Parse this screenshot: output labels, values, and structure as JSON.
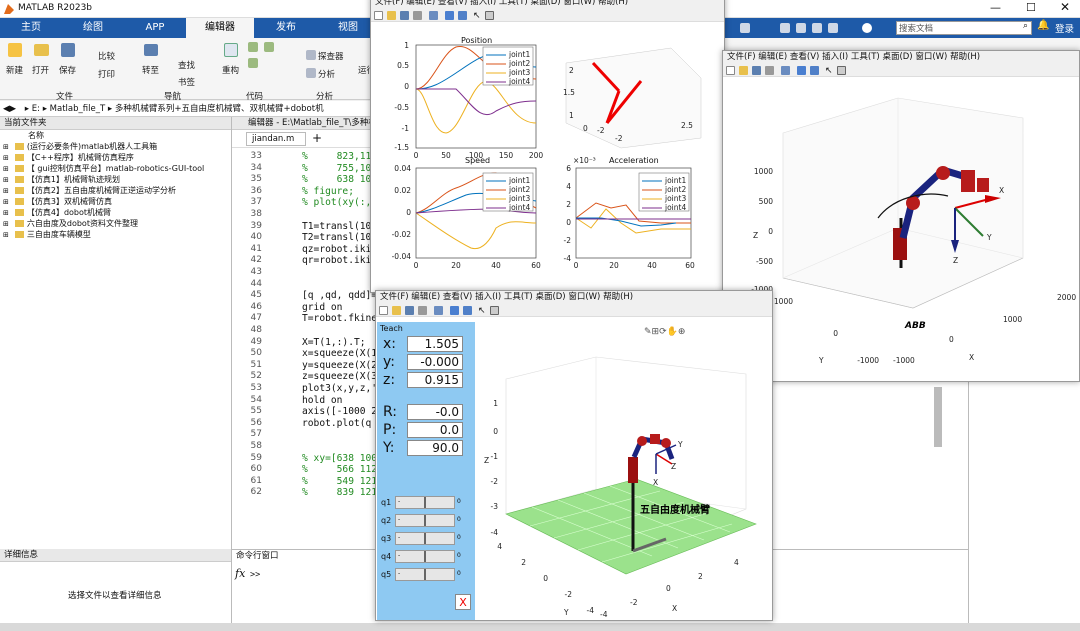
{
  "app": {
    "title": "MATLAB R2023b",
    "search_placeholder": "搜索文档",
    "login": "登录"
  },
  "tabs": [
    "主页",
    "绘图",
    "APP",
    "编辑器",
    "发布",
    "视图"
  ],
  "ribbon": {
    "buttons": [
      "新建",
      "打开",
      "保存",
      "比较",
      "打印",
      "转至",
      "查找",
      "书签",
      "重构",
      "探查器",
      "分析",
      "运行"
    ],
    "groups": [
      "文件",
      "导航",
      "代码",
      "分析"
    ]
  },
  "addressbar": {
    "path": "▸ E: ▸ Matlab_file_T ▸ 多种机械臂系列+五自由度机械臂、双机械臂+dobot机"
  },
  "editor_title": "编辑器 - E:\\Matlab_file_T\\多种机",
  "editor_tab": "jiandan.m",
  "current_folder": {
    "title": "当前文件夹",
    "col_name": "名称",
    "items": [
      "(运行必要条件)matlab机器人工具箱",
      "【C++程序】机械臂仿真程序",
      "【 gui控制仿真平台】matlab-robotics-GUI-tool",
      "【仿真1】机械臂轨迹规划",
      "【仿真2】五自由度机械臂正逆运动学分析",
      "【仿真3】双机械臂仿真",
      "【仿真4】dobot机械臂",
      "六自由度及dobot资料文件整理",
      "三自由度车辆模型"
    ]
  },
  "details": {
    "title": "详细信息",
    "hint": "选择文件以查看详细信息"
  },
  "command_window": {
    "title": "命令行窗口",
    "prompt": ">>"
  },
  "code_lines": [
    {
      "n": "33",
      "t": "%     823,11"
    },
    {
      "n": "34",
      "t": "%     755,10"
    },
    {
      "n": "35",
      "t": "%     638 10"
    },
    {
      "n": "36",
      "t": "% figure;"
    },
    {
      "n": "37",
      "t": "% plot(xy(:,"
    },
    {
      "n": "38",
      "t": ""
    },
    {
      "n": "39",
      "t": "T1=transl(10"
    },
    {
      "n": "40",
      "t": "T2=transl(10"
    },
    {
      "n": "41",
      "t": "qz=robot.iki"
    },
    {
      "n": "42",
      "t": "qr=robot.iki"
    },
    {
      "n": "43",
      "t": ""
    },
    {
      "n": "44",
      "t": ""
    },
    {
      "n": "45",
      "t": "[q ,qd, qdd]="
    },
    {
      "n": "46",
      "t": "grid on"
    },
    {
      "n": "47",
      "t": "T=robot.fkine"
    },
    {
      "n": "48",
      "t": ""
    },
    {
      "n": "49",
      "t": "X=T(1,:).T;"
    },
    {
      "n": "50",
      "t": "x=squeeze(X(1"
    },
    {
      "n": "51",
      "t": "y=squeeze(X(2"
    },
    {
      "n": "52",
      "t": "z=squeeze(X(3"
    },
    {
      "n": "53",
      "t": "plot3(x,y,z,'"
    },
    {
      "n": "54",
      "t": "hold on"
    },
    {
      "n": "55",
      "t": "axis([-1000 2"
    },
    {
      "n": "56",
      "t": "robot.plot(q"
    },
    {
      "n": "57",
      "t": ""
    },
    {
      "n": "58",
      "t": ""
    },
    {
      "n": "59",
      "t": "% xy=[638 100"
    },
    {
      "n": "60",
      "t": "%     566 112"
    },
    {
      "n": "61",
      "t": "%     549 121"
    },
    {
      "n": "62",
      "t": "%     839 121"
    }
  ],
  "fig_menu": "文件(F)  编辑(E)  查看(V)  插入(I)  工具(T)  桌面(D)  窗口(W)  帮助(H)",
  "fig1": {
    "title_top": "Position",
    "title_speed": "Speed",
    "title_acc": "Acceleration",
    "acc_exp": "×10⁻³",
    "legend": [
      "joint1",
      "joint2",
      "joint3",
      "joint4"
    ],
    "colors": [
      "#0072bd",
      "#d95319",
      "#edb120",
      "#7e2f8e"
    ],
    "pos_y": [
      "1",
      "0.5",
      "0",
      "-0.5",
      "-1",
      "-1.5"
    ],
    "pos_x": [
      "0",
      "50",
      "100",
      "150",
      "200"
    ],
    "spd_y": [
      "0.04",
      "0.02",
      "0",
      "-0.02",
      "-0.04"
    ],
    "spd_x": [
      "0",
      "20",
      "40",
      "60"
    ],
    "acc_y": [
      "6",
      "4",
      "2",
      "0",
      "-2",
      "-4"
    ],
    "acc_x": [
      "0",
      "20",
      "40",
      "60"
    ],
    "r3d_z": [
      "2",
      "1.5",
      "1"
    ],
    "r3d_x": [
      "0",
      "-2",
      "-2",
      "2.5"
    ]
  },
  "fig2": {
    "z_ticks": [
      "1000",
      "500",
      "0",
      "-500",
      "-1000"
    ],
    "y_ticks": [
      "1000",
      "0",
      "-1000"
    ],
    "x_ticks": [
      "-1000",
      "0",
      "1000",
      "2000"
    ],
    "xlab": "X",
    "ylab": "Y",
    "zlab": "Z",
    "robot_label": "ABB"
  },
  "fig3": {
    "teach": "Teach",
    "x": {
      "label": "x:",
      "value": "1.505"
    },
    "y": {
      "label": "y:",
      "value": "-0.000"
    },
    "z": {
      "label": "z:",
      "value": "0.915"
    },
    "r": {
      "label": "R:",
      "value": "-0.0"
    },
    "p": {
      "label": "P:",
      "value": "0.0"
    },
    "yaw": {
      "label": "Y:",
      "value": "90.0"
    },
    "joints": [
      "q1",
      "q2",
      "q3",
      "q4",
      "q5"
    ],
    "slider_min": "-",
    "slider_max": "0",
    "close": "X",
    "z_ticks": [
      "1",
      "0",
      "-1",
      "-2",
      "-3",
      "-4"
    ],
    "y_ticks": [
      "4",
      "2",
      "0",
      "-2",
      "-4"
    ],
    "x_ticks": [
      "-4",
      "-2",
      "0",
      "2",
      "4"
    ],
    "zlab": "Z",
    "xlab": "X",
    "ylab": "Y",
    "robot_label": "五自由度机械臂"
  },
  "status": {
    "fill": "#d9d9d9"
  }
}
